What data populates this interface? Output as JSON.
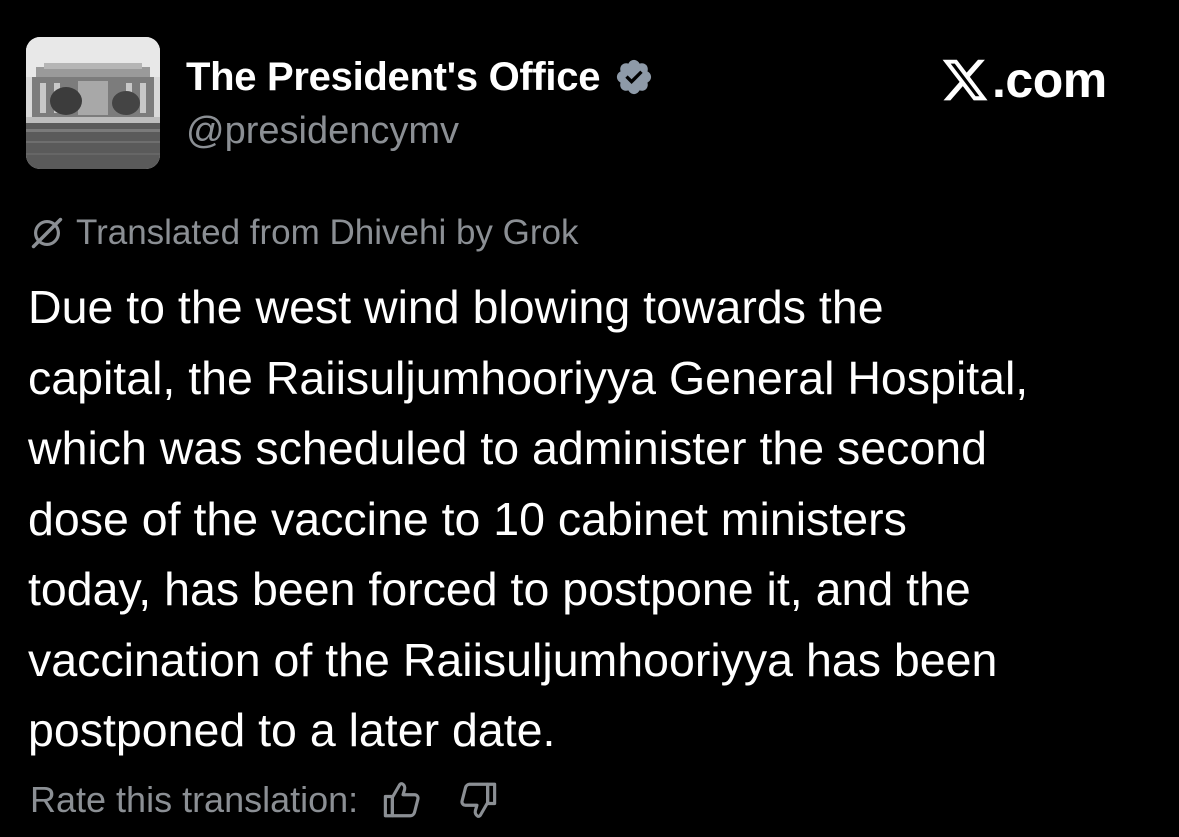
{
  "author": {
    "display_name": "The President's Office",
    "handle": "@presidencymv",
    "verified": true,
    "avatar": "presidential-building-photo"
  },
  "brand": {
    "logo": "x-logo-icon",
    "text": ".com"
  },
  "translation": {
    "icon": "grok-icon",
    "label": "Translated from Dhivehi by Grok"
  },
  "tweet": {
    "lines": [
      "Due to the west wind blowing towards the",
      "capital, the Raiisuljumhooriyya General Hospital,",
      "which was scheduled to administer the second",
      "dose of the vaccine to 10 cabinet ministers",
      "today, has been forced to postpone it, and the",
      "vaccination of the Raiisuljumhooriyya has been",
      "postponed to a later date."
    ]
  },
  "rating": {
    "label": "Rate this translation:",
    "thumbs_up_icon": "thumbs-up-icon",
    "thumbs_down_icon": "thumbs-down-icon"
  },
  "colors": {
    "background": "#000000",
    "primary_text": "#ffffff",
    "secondary_text": "#8b8f94",
    "verified_badge": "#8e9aa8"
  }
}
